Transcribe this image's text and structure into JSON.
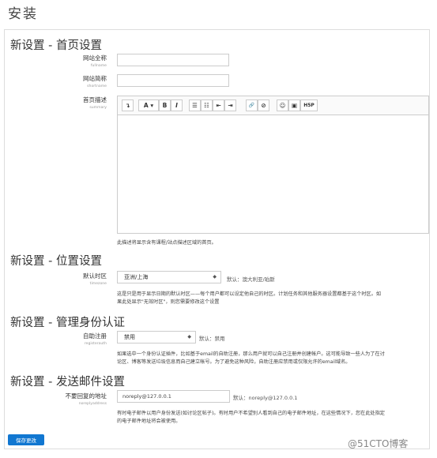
{
  "page_title": "安装",
  "sections": {
    "frontpage": {
      "title": "新设置 - 首页设置",
      "fullname": {
        "label": "网站全称",
        "sub": "fullname"
      },
      "shortname": {
        "label": "网站简称",
        "sub": "shortname"
      },
      "summary": {
        "label": "首页描述",
        "sub": "summary"
      },
      "help": "此描述将显示含有课程/站点描述区域的首页。"
    },
    "location": {
      "title": "新设置 - 位置设置",
      "timezone": {
        "label": "默认时区",
        "sub": "timezone",
        "value": "亚洲/上海",
        "default": "默认：澳大利亚/珀斯"
      },
      "help_line1": "这是只是用于显示日期的默认时区——每个用户都可以设定他自己的时区。计划任务和其他服务器设置都基于这个时区。如",
      "help_line2": "果此处显示\"无效时区\"，则您需要修改这个设置"
    },
    "auth": {
      "title": "新设置 - 管理身份认证",
      "registerauth": {
        "label": "自助注册",
        "sub": "registerauth",
        "value": "禁用",
        "default": "默认：禁用"
      },
      "help_line1": "如果选中一个身份认证插件，比如基于email的自助注册，那么用户就可以自己注册并创建帐户。这可能导致一些人为了在讨",
      "help_line2": "论区、博客等发送垃圾信息而自己建立帐号。为了避免这种风险，自助注册应禁用或仅限允许的email域名。"
    },
    "email": {
      "title": "新设置 - 发送邮件设置",
      "noreply": {
        "label": "不要回复的地址",
        "sub": "noreplyaddress",
        "value": "noreply@127.0.0.1",
        "default": "默认：noreply@127.0.0.1"
      },
      "help_line1": "有时电子邮件以用户身份发送(如讨论区帖子)。有时用户不希望别人看到自己的电子邮件地址，在这些情况下，您在此处指定",
      "help_line2": "的电子邮件地址将会被使用。"
    }
  },
  "toolbar": [
    "↴",
    "A ▾",
    "B",
    "I",
    "☰",
    "☷",
    "⇤",
    "⇥",
    "🔗",
    "⊘",
    "☺",
    "▣",
    "H5P"
  ],
  "save_label": "保存更改",
  "watermark": "@51CTO博客"
}
